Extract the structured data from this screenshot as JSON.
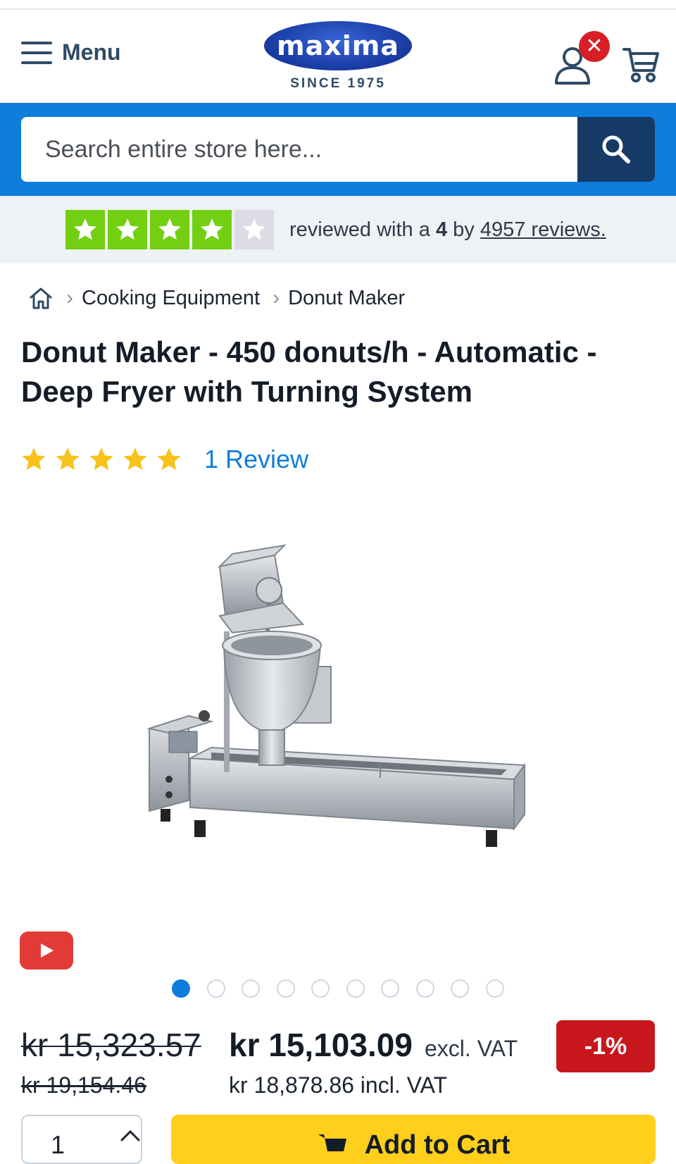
{
  "header": {
    "menu_label": "Menu",
    "logo_text": "maxima",
    "logo_since": "SINCE 1975",
    "badge_symbol": "✕",
    "badge_color": "#d81f26"
  },
  "search": {
    "placeholder": "Search entire store here...",
    "band_color": "#0f7ddb",
    "button_color": "#153a66"
  },
  "trustpilot": {
    "stars_filled": 4,
    "stars_total": 5,
    "text_prefix": "reviewed with a",
    "score": "4",
    "text_mid": "by",
    "reviews_link": "4957 reviews."
  },
  "breadcrumb": {
    "home_icon": "home-icon",
    "items": [
      "Cooking Equipment",
      "Donut Maker"
    ]
  },
  "product": {
    "title": "Donut Maker - 450 donuts/h - Automatic - Deep Fryer with Turning System",
    "rating_stars": 5,
    "review_link": "1 Review",
    "gallery_count": 10,
    "gallery_active_index": 0
  },
  "pricing": {
    "old_price": "kr 15,323.57",
    "old_price_incl": "kr 19,154.46",
    "new_price": "kr 15,103.09",
    "excl_label": "excl. VAT",
    "incl_price": "kr 18,878.86",
    "incl_label": "incl. VAT",
    "discount": "-1%",
    "discount_color": "#c8161d"
  },
  "purchase": {
    "quantity": "1",
    "add_to_cart": "Add to Cart",
    "button_color": "#ffcf1b"
  }
}
